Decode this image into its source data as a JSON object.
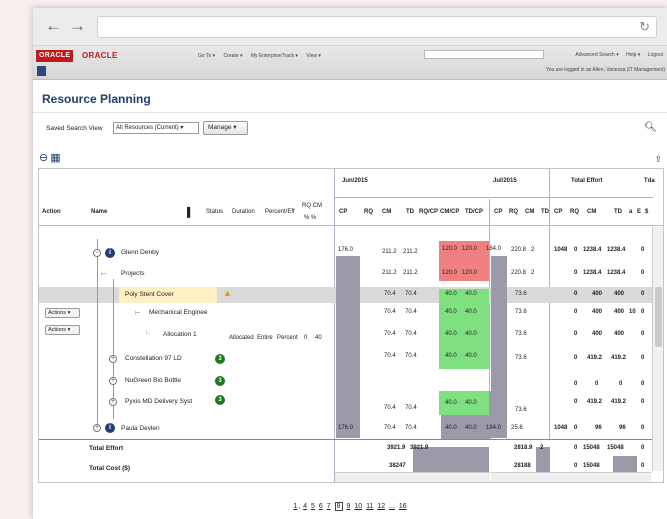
{
  "header": {
    "logo_badge": "ORACLE",
    "logo_text": "ORACLE",
    "menu": [
      "Go To ▾",
      "Create ▾",
      "My EnterpriseTrack ▾",
      "View ▾"
    ],
    "links": [
      "Advanced Search ▾",
      "Help ▾",
      "Logout"
    ],
    "user_line": "You are logged in as Allen, Vanessa (IT Management)"
  },
  "page": {
    "title": "Resource Planning"
  },
  "toolbar": {
    "saved_search_label": "Saved Search View",
    "view_value": "All Resources (Current)",
    "manage_label": "Manage"
  },
  "grid": {
    "headers": {
      "action": "Action",
      "name": "Name",
      "status": "Status",
      "duration": "Duration",
      "percent": "Percent/Eff",
      "rq_cm": "RQ CM",
      "pct": "%  %"
    },
    "periods": {
      "jun": "Jun/2015",
      "jul": "Jul/2015",
      "total": "Total Effort",
      "tda": "Tda"
    },
    "subcols_jun": [
      "CP",
      "RQ",
      "CM",
      "TD",
      "RQ/CP",
      "CM/CP",
      "TD/CP"
    ],
    "subcols_jul": [
      "CP",
      "RQ",
      "CM",
      "TD"
    ],
    "subcols_total": [
      "CP",
      "RQ",
      "CM",
      "TD",
      "a",
      "E",
      "$"
    ],
    "rows": [
      {
        "name": "Glenn Denby",
        "cp": "176.0",
        "cm": "211.2",
        "td": "211.2",
        "rqcp": "120.0",
        "cmcp": "120.0",
        "tdcp": "184.0",
        "jul_rq": "220.8",
        "jul_cm": "2",
        "tot_cp": "1048",
        "tot_rq": "0",
        "tot_cm": "1238.4",
        "tot_td": "1238.4",
        "tot_e": "0"
      },
      {
        "name": "Projects",
        "cm": "211.2",
        "td": "211.2",
        "rqcp": "120.0",
        "cmcp": "120.0",
        "jul_rq": "220.8",
        "jul_cm": "2",
        "tot_rq": "0",
        "tot_cm": "1238.4",
        "tot_td": "1238.4",
        "tot_e": "0"
      },
      {
        "name": "Poly Stent Cover",
        "cm": "70.4",
        "td": "70.4",
        "rqcp": "40.0",
        "cmcp": "40.0",
        "jul_rq": "73.6",
        "tot_rq": "0",
        "tot_cm": "400",
        "tot_td": "400",
        "tot_e": "0"
      },
      {
        "name": "Mechanical Enginee",
        "cm": "70.4",
        "td": "70.4",
        "rqcp": "40.0",
        "cmcp": "40.0",
        "jul_rq": "73.6",
        "tot_rq": "0",
        "tot_cm": "400",
        "tot_td": "400",
        "tot_e": "10",
        "tot_x": "0"
      },
      {
        "name": "Allocation 1",
        "status": "Allocated",
        "duration": "Entire",
        "percent": "Percent",
        "rq": "0",
        "cm": "40",
        "cm2": "70.4",
        "td": "70.4",
        "rqcp": "40.0",
        "cmcp": "40.0",
        "jul_rq": "73.6",
        "tot_rq": "0",
        "tot_cm": "400",
        "tot_td": "400",
        "tot_e": "0"
      },
      {
        "name": "Constellation 97 LD",
        "badge": "3",
        "cm": "70.4",
        "td": "70.4",
        "rqcp": "40.0",
        "cmcp": "40.0",
        "jul_rq": "73.6",
        "tot_rq": "0",
        "tot_cm": "419.2",
        "tot_td": "419.2",
        "tot_e": "0"
      },
      {
        "name": "NuGreen Bio Bottle",
        "badge": "3",
        "tot_rq": "0",
        "tot_cm": "0",
        "tot_td": "0",
        "tot_e": "0"
      },
      {
        "name": "Pyxis MD Delivery Syst",
        "badge": "3",
        "cm": "70.4",
        "td": "70.4",
        "rqcp": "40.0",
        "cmcp": "40.0",
        "jul_rq": "73.6",
        "tot_rq": "0",
        "tot_cm": "419.2",
        "tot_td": "419.2",
        "tot_e": "0"
      },
      {
        "name": "Paula Devlen",
        "cp": "176.0",
        "cm": "70.4",
        "td": "70.4",
        "rqcp": "40.0",
        "cmcp": "40.0",
        "tdcp": "184.0",
        "jul_rq": "25.6",
        "tot_cp": "1048",
        "tot_rq": "0",
        "tot_cm": "96",
        "tot_td": "96",
        "tot_e": "0"
      }
    ],
    "total_effort": {
      "label": "Total Effort",
      "cm": "3921.9",
      "td": "3921.9",
      "jul": "2818.9",
      "jul2": "2",
      "tot_rq": "0",
      "tot_cm": "15048",
      "tot_td": "15048",
      "tot_e": "0"
    },
    "total_cost": {
      "label": "Total Cost ($)",
      "cm": "38247",
      "jul": "28188",
      "tot_rq": "0",
      "tot_cm": "15048",
      "tot_e": "0"
    },
    "action_label": "Actions ▾"
  },
  "pager": {
    "pages": [
      "1",
      "4",
      "5",
      "6",
      "7",
      "8",
      "9",
      "10",
      "11",
      "12",
      "...",
      "16"
    ],
    "current": "8"
  },
  "colors": {
    "green": "#7ee07e",
    "red": "#f08080",
    "gray_block": "#9a9aa8",
    "title": "#1f3f6e"
  }
}
